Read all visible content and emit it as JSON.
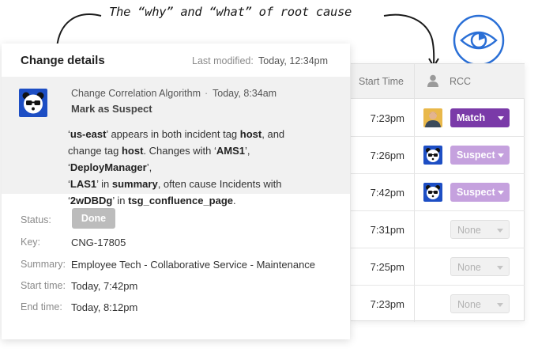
{
  "annotation": {
    "text": "The “why” and “what” of root cause"
  },
  "details": {
    "title": "Change details",
    "last_modified_label": "Last modified:",
    "last_modified_value": "Today, 12:34pm",
    "event": {
      "source": "Change Correlation Algorithm",
      "separator": "·",
      "time": "Today, 8:34am",
      "action": "Mark as Suspect",
      "body": {
        "q1": "‘",
        "t1": "us-east",
        "q2": "’ appears in both incident tag ",
        "t2": "host",
        "q3": ", and",
        "q4": "change tag ",
        "t3": "host",
        "q5": ". Changes with ‘",
        "t4": "AMS1",
        "q6": "’, ‘",
        "t5": "DeployManager",
        "q7": "’,",
        "q8": "‘",
        "t6": "LAS1",
        "q9": "’ in ",
        "t7": "summary",
        "q10": ", often cause Incidents with",
        "q11": "‘",
        "t8": "2wDBDg",
        "q12": "’ in ",
        "t9": "tsg_confluence_page",
        "q13": "."
      }
    },
    "fields": {
      "status_label": "Status:",
      "status_value": "Done",
      "key_label": "Key:",
      "key_value": "CNG-17805",
      "summary_label": "Summary:",
      "summary_value": "Employee Tech - Collaborative Service - Maintenance",
      "start_label": "Start time:",
      "start_value": "Today, 7:42pm",
      "end_label": "End time:",
      "end_value": "Today, 8:12pm"
    }
  },
  "table": {
    "header_start": "Start Time",
    "header_rcc": "RCC",
    "rows": [
      {
        "time": "7:23pm",
        "avatar": "person-photo",
        "rcc": "Match"
      },
      {
        "time": "7:26pm",
        "avatar": "bigpanda-bear",
        "rcc": "Suspect"
      },
      {
        "time": "7:42pm",
        "avatar": "bigpanda-bear",
        "rcc": "Suspect"
      },
      {
        "time": "7:31pm",
        "avatar": "",
        "rcc": "None"
      },
      {
        "time": "7:25pm",
        "avatar": "",
        "rcc": "None"
      },
      {
        "time": "7:23pm",
        "avatar": "",
        "rcc": "None"
      }
    ]
  },
  "colors": {
    "match": "#7a3aa8",
    "suspect": "#c5a1de",
    "brand_blue": "#1d4ec4",
    "eye_blue": "#2a6fd6"
  },
  "icons": {
    "eye_badge": "eye-icon",
    "bear": "panda-bear-icon",
    "user": "user-icon"
  }
}
